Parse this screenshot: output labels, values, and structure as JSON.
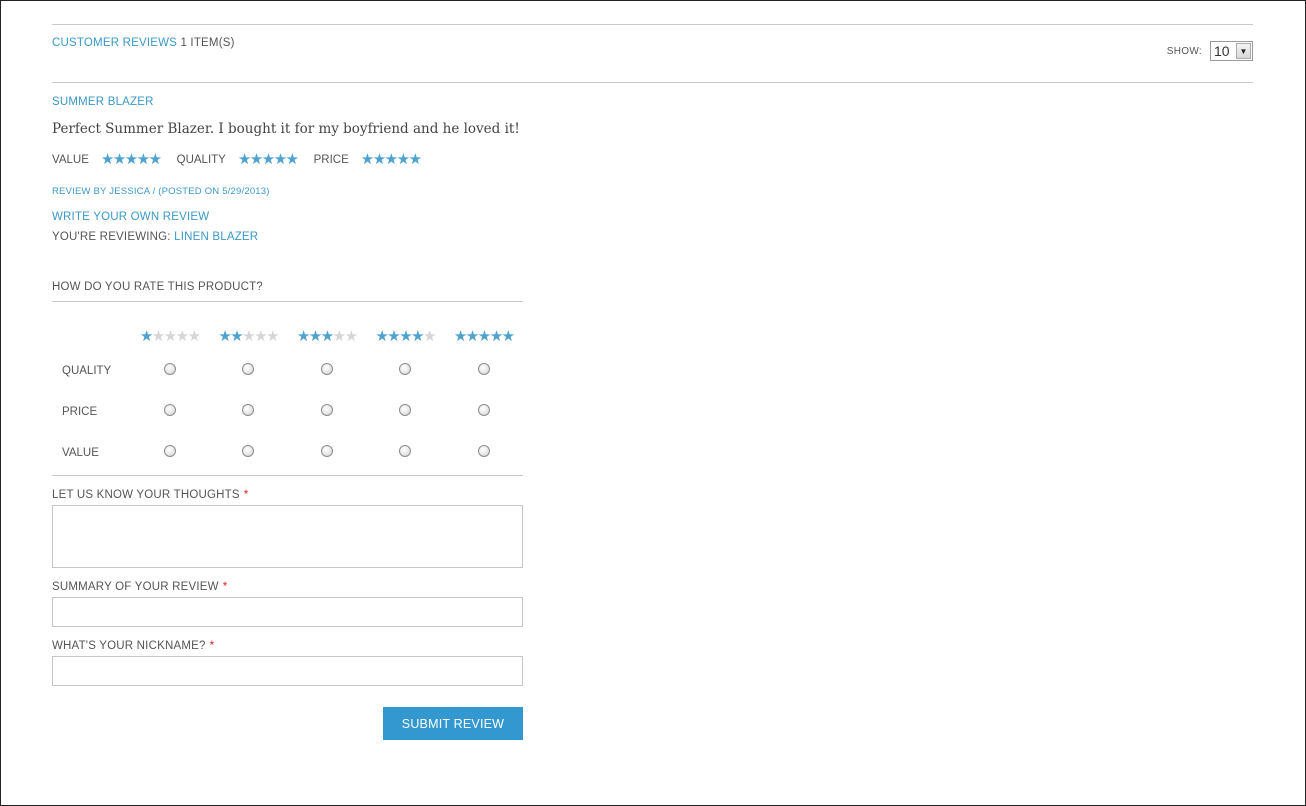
{
  "header": {
    "section_title": "CUSTOMER REVIEWS",
    "item_count": "1 ITEM(S)",
    "show_label": "SHOW:",
    "show_value": "10"
  },
  "review": {
    "title": "SUMMER BLAZER",
    "body": "Perfect Summer Blazer. I bought it for my boyfriend and he loved it!",
    "ratings": [
      {
        "label": "VALUE",
        "stars": 5
      },
      {
        "label": "QUALITY",
        "stars": 5
      },
      {
        "label": "PRICE",
        "stars": 5
      }
    ],
    "byline": "REVIEW BY JESSICA / (POSTED ON 5/29/2013)"
  },
  "write_link": "WRITE YOUR OWN REVIEW",
  "reviewing": {
    "prefix": "YOU'RE REVIEWING:",
    "product": "LINEN BLAZER"
  },
  "form": {
    "question": "HOW DO YOU RATE THIS PRODUCT?",
    "columns": [
      1,
      2,
      3,
      4,
      5
    ],
    "rows": [
      "QUALITY",
      "PRICE",
      "VALUE"
    ],
    "thoughts_label": "LET US KNOW YOUR THOUGHTS",
    "summary_label": "SUMMARY OF YOUR REVIEW",
    "nickname_label": "WHAT'S YOUR NICKNAME?",
    "required_mark": "*",
    "submit_label": "SUBMIT REVIEW"
  },
  "colors": {
    "accent": "#3d98c6",
    "star_on": "#4fa2cf",
    "star_off": "#d6d6d6",
    "button": "#3298cf",
    "required": "#e02020"
  },
  "icons": {
    "star": "star-icon",
    "select_caret": "chevron-down-icon"
  }
}
